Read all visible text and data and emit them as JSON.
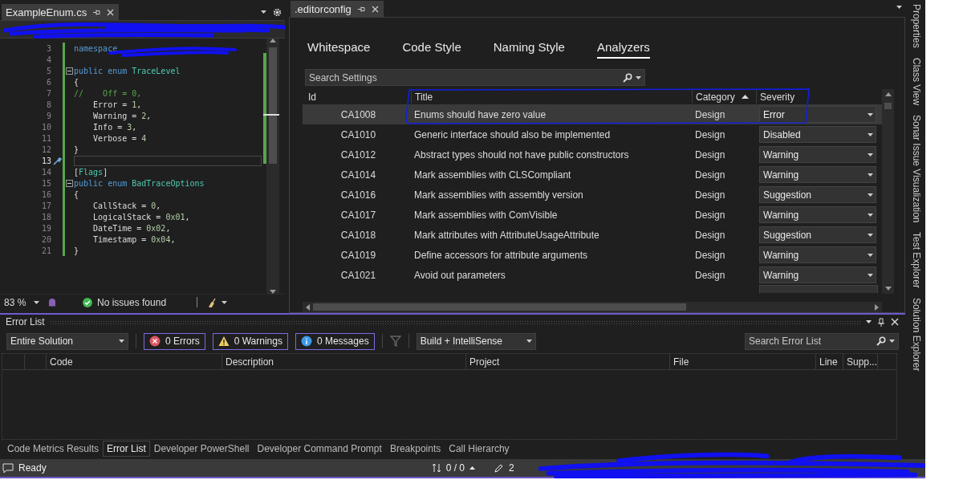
{
  "editor": {
    "tab": {
      "title": "ExampleEnum.cs",
      "selected": true
    },
    "lines": [
      {
        "number": "3",
        "current": false,
        "foldable": false,
        "tokens": [
          {
            "kind": "keyword",
            "text": "namespace"
          }
        ]
      },
      {
        "number": "4",
        "current": false,
        "foldable": false
      },
      {
        "number": "5",
        "current": false,
        "foldable": true,
        "tokens": [
          {
            "kind": "keyword",
            "text": "public enum "
          },
          {
            "kind": "type",
            "text": "TraceLevel"
          }
        ]
      },
      {
        "number": "6",
        "current": false,
        "foldable": false,
        "tokens": [
          {
            "kind": "plain",
            "text": "{"
          }
        ]
      },
      {
        "number": "7",
        "current": false,
        "foldable": false,
        "tokens": [
          {
            "kind": "comment",
            "text": "//    Off = 0,"
          }
        ]
      },
      {
        "number": "8",
        "current": false,
        "foldable": false,
        "tokens": [
          {
            "kind": "plain",
            "text": "    Error = "
          },
          {
            "kind": "number",
            "text": "1"
          },
          {
            "kind": "plain",
            "text": ","
          }
        ]
      },
      {
        "number": "9",
        "current": false,
        "foldable": false,
        "tokens": [
          {
            "kind": "plain",
            "text": "    Warning = "
          },
          {
            "kind": "number",
            "text": "2"
          },
          {
            "kind": "plain",
            "text": ","
          }
        ]
      },
      {
        "number": "10",
        "current": false,
        "foldable": false,
        "tokens": [
          {
            "kind": "plain",
            "text": "    Info = "
          },
          {
            "kind": "number",
            "text": "3"
          },
          {
            "kind": "plain",
            "text": ","
          }
        ]
      },
      {
        "number": "11",
        "current": false,
        "foldable": false,
        "tokens": [
          {
            "kind": "plain",
            "text": "    Verbose = "
          },
          {
            "kind": "number",
            "text": "4"
          }
        ]
      },
      {
        "number": "12",
        "current": false,
        "foldable": false,
        "tokens": [
          {
            "kind": "plain",
            "text": "}"
          }
        ]
      },
      {
        "number": "13",
        "current": true,
        "foldable": false
      },
      {
        "number": "14",
        "current": false,
        "foldable": false,
        "tokens": [
          {
            "kind": "plain",
            "text": "["
          },
          {
            "kind": "type",
            "text": "Flags"
          },
          {
            "kind": "plain",
            "text": "]"
          }
        ]
      },
      {
        "number": "15",
        "current": false,
        "foldable": true,
        "tokens": [
          {
            "kind": "keyword",
            "text": "public enum "
          },
          {
            "kind": "type",
            "text": "BadTraceOptions"
          }
        ]
      },
      {
        "number": "16",
        "current": false,
        "foldable": false,
        "tokens": [
          {
            "kind": "plain",
            "text": "{"
          }
        ]
      },
      {
        "number": "17",
        "current": false,
        "foldable": false,
        "tokens": [
          {
            "kind": "plain",
            "text": "    CallStack = "
          },
          {
            "kind": "number",
            "text": "0"
          },
          {
            "kind": "plain",
            "text": ","
          }
        ]
      },
      {
        "number": "18",
        "current": false,
        "foldable": false,
        "tokens": [
          {
            "kind": "plain",
            "text": "    LogicalStack = "
          },
          {
            "kind": "number",
            "text": "0x01"
          },
          {
            "kind": "plain",
            "text": ","
          }
        ]
      },
      {
        "number": "19",
        "current": false,
        "foldable": false,
        "tokens": [
          {
            "kind": "plain",
            "text": "    DateTime = "
          },
          {
            "kind": "number",
            "text": "0x02"
          },
          {
            "kind": "plain",
            "text": ","
          }
        ]
      },
      {
        "number": "20",
        "current": false,
        "foldable": false,
        "tokens": [
          {
            "kind": "plain",
            "text": "    Timestamp = "
          },
          {
            "kind": "number",
            "text": "0x04"
          },
          {
            "kind": "plain",
            "text": ","
          }
        ]
      },
      {
        "number": "21",
        "current": false,
        "foldable": false,
        "tokens": [
          {
            "kind": "plain",
            "text": "}"
          }
        ]
      }
    ],
    "zoom": "83 %",
    "issues": "No issues found"
  },
  "editorconfig": {
    "tab": {
      "title": ".editorconfig",
      "selected": true
    },
    "tabs": [
      {
        "label": "Whitespace",
        "selected": false
      },
      {
        "label": "Code Style",
        "selected": false
      },
      {
        "label": "Naming Style",
        "selected": false
      },
      {
        "label": "Analyzers",
        "selected": true
      }
    ],
    "search": {
      "placeholder": "Search Settings"
    },
    "columns": [
      {
        "label": "Id",
        "sorted": false
      },
      {
        "label": "Title",
        "sorted": false
      },
      {
        "label": "Category",
        "sorted": true
      },
      {
        "label": "Severity",
        "sorted": false
      }
    ],
    "rows": [
      {
        "id": "CA1008",
        "title": "Enums should have zero value",
        "category": "Design",
        "severity": "Error",
        "selected": true
      },
      {
        "id": "CA1010",
        "title": "Generic interface should also be implemented",
        "category": "Design",
        "severity": "Disabled",
        "selected": false
      },
      {
        "id": "CA1012",
        "title": "Abstract types should not have public constructors",
        "category": "Design",
        "severity": "Warning",
        "selected": false
      },
      {
        "id": "CA1014",
        "title": "Mark assemblies with CLSCompliant",
        "category": "Design",
        "severity": "Warning",
        "selected": false
      },
      {
        "id": "CA1016",
        "title": "Mark assemblies with assembly version",
        "category": "Design",
        "severity": "Suggestion",
        "selected": false
      },
      {
        "id": "CA1017",
        "title": "Mark assemblies with ComVisible",
        "category": "Design",
        "severity": "Warning",
        "selected": false
      },
      {
        "id": "CA1018",
        "title": "Mark attributes with AttributeUsageAttribute",
        "category": "Design",
        "severity": "Suggestion",
        "selected": false
      },
      {
        "id": "CA1019",
        "title": "Define accessors for attribute arguments",
        "category": "Design",
        "severity": "Warning",
        "selected": false
      },
      {
        "id": "CA1021",
        "title": "Avoid out parameters",
        "category": "Design",
        "severity": "Warning",
        "selected": false
      }
    ]
  },
  "error_list": {
    "title": "Error List",
    "scope": "Entire Solution",
    "filters": [
      {
        "kind": "error",
        "label": "0 Errors",
        "on": true
      },
      {
        "kind": "warning",
        "label": "0 Warnings",
        "on": true
      },
      {
        "kind": "message",
        "label": "0 Messages",
        "on": true
      }
    ],
    "source": "Build + IntelliSense",
    "search": {
      "placeholder": "Search Error List"
    },
    "columns": [
      "Code",
      "Description",
      "Project",
      "File",
      "Line",
      "Supp..."
    ]
  },
  "bottom_tabs": [
    {
      "label": "Code Metrics Results",
      "selected": false
    },
    {
      "label": "Error List",
      "selected": true
    },
    {
      "label": "Developer PowerShell",
      "selected": false
    },
    {
      "label": "Developer Command Prompt",
      "selected": false
    },
    {
      "label": "Breakpoints",
      "selected": false
    },
    {
      "label": "Call Hierarchy",
      "selected": false
    }
  ],
  "status_bar": {
    "state": "Ready",
    "errors_nav": "0 / 0",
    "changes": "2"
  },
  "side_tabs": [
    "Properties",
    "Class View",
    "Sonar Issue Visualization",
    "Test Explorer",
    "Solution Explorer"
  ]
}
